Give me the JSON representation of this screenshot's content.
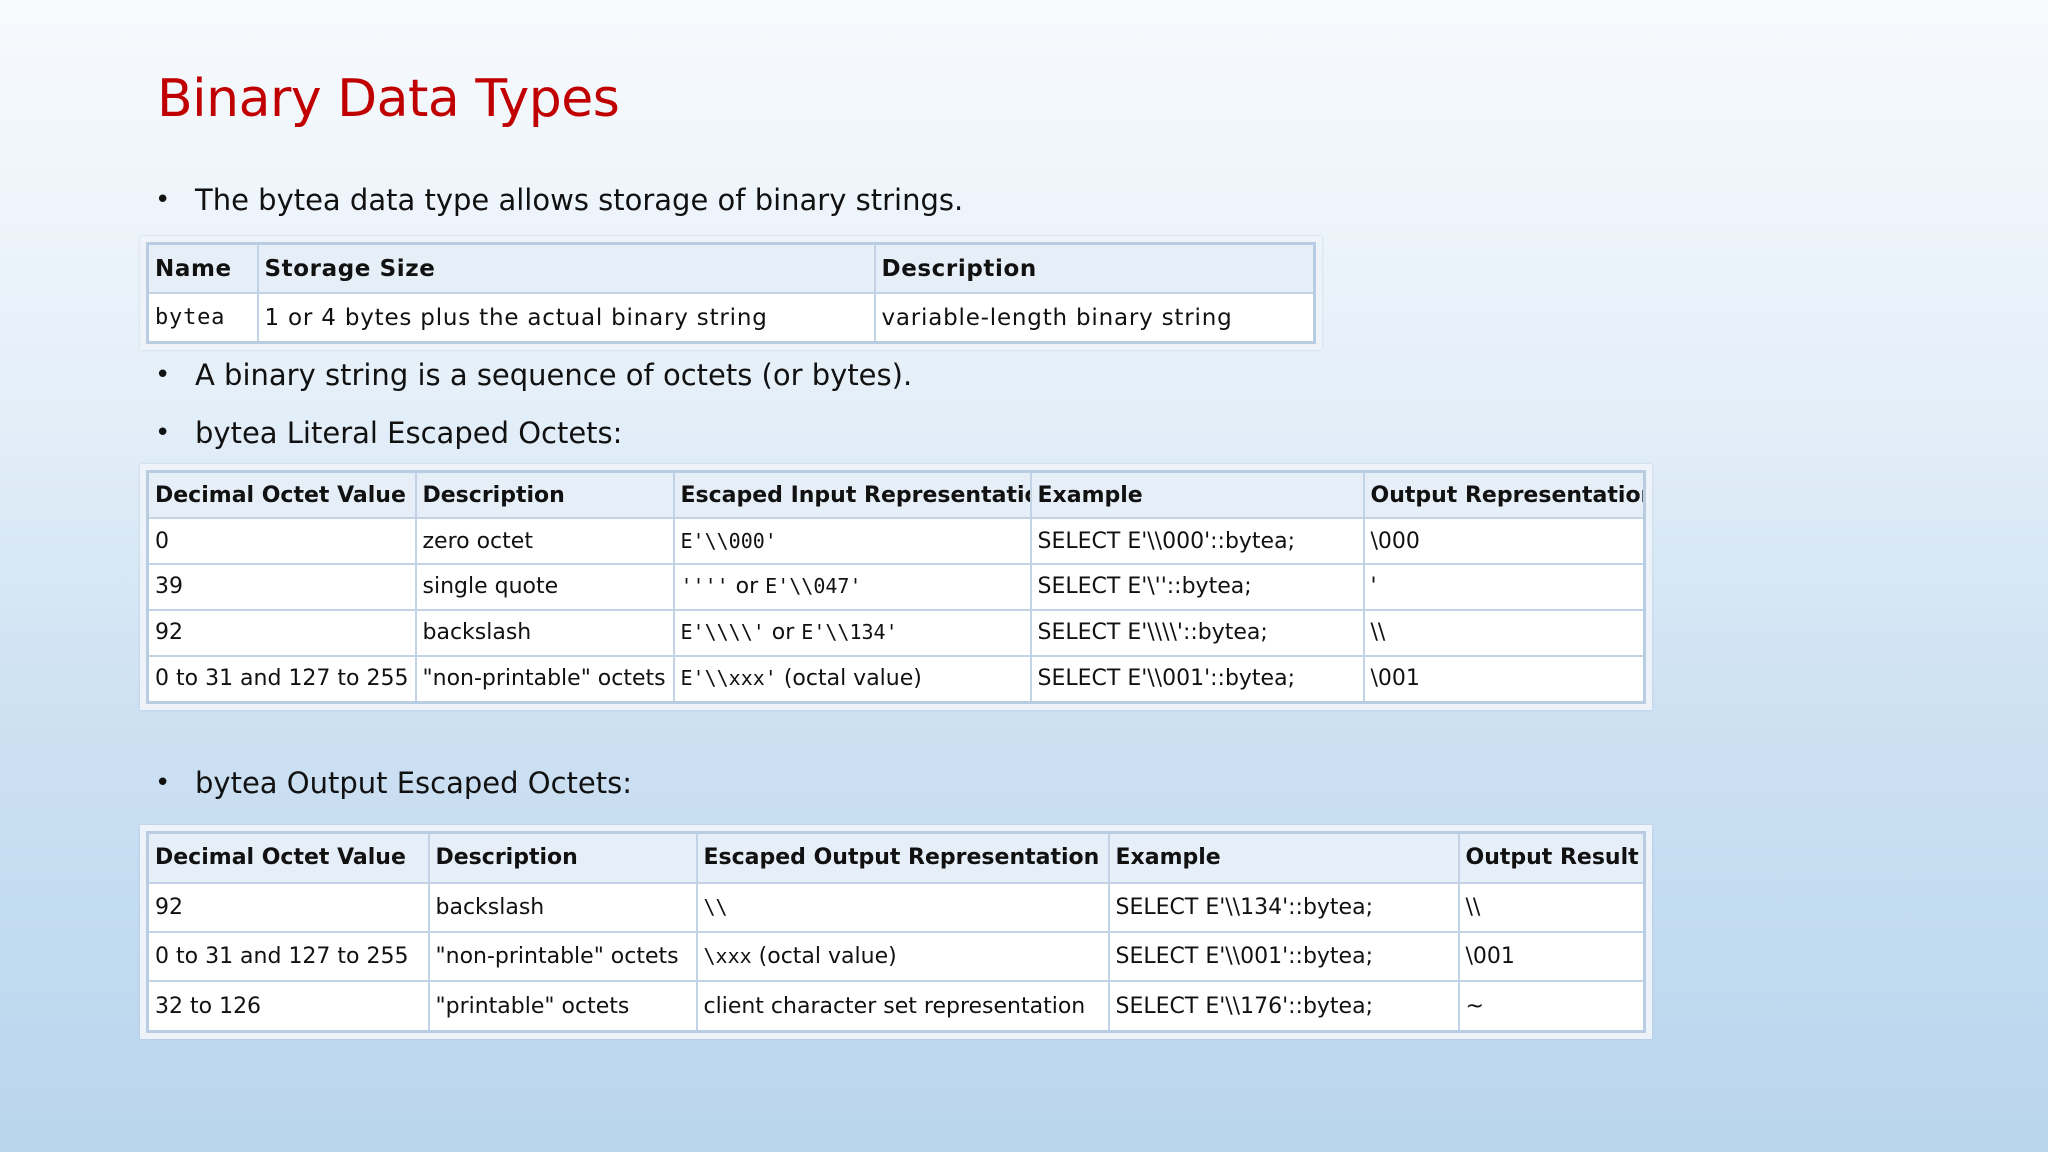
{
  "slide": {
    "title": "Binary Data Types",
    "bullets": [
      "The bytea data type allows storage of binary strings.",
      "A binary string is a sequence of octets (or bytes).",
      "bytea Literal Escaped Octets:",
      "bytea Output Escaped Octets:"
    ],
    "bullet_symbol": "•"
  },
  "storage_table": {
    "headers": [
      "Name",
      "Storage Size",
      "Description"
    ],
    "rows": [
      [
        "bytea",
        "1 or 4 bytes plus the actual binary string",
        "variable-length binary string"
      ]
    ]
  },
  "literal_table": {
    "headers": [
      "Decimal Octet Value",
      "Description",
      "Escaped Input Representation",
      "Example",
      "Output Representation"
    ],
    "rows": [
      {
        "value": "0",
        "description": "zero octet",
        "escaped": {
          "code1": "E'\\\\000'",
          "sep": "",
          "code2": "",
          "note": ""
        },
        "example": "SELECT E'\\\\000'::bytea;",
        "output": "\\000"
      },
      {
        "value": "39",
        "description": "single quote",
        "escaped": {
          "code1": "''''",
          "sep": " or ",
          "code2": "E'\\\\047'",
          "note": ""
        },
        "example": "SELECT E'\\''::bytea;",
        "output": "'"
      },
      {
        "value": "92",
        "description": "backslash",
        "escaped": {
          "code1": "E'\\\\\\\\'",
          "sep": " or ",
          "code2": "E'\\\\134'",
          "note": ""
        },
        "example": "SELECT E'\\\\\\\\'::bytea;",
        "output": "\\\\"
      },
      {
        "value": "0 to 31 and 127 to 255",
        "description": "\"non-printable\" octets",
        "escaped": {
          "code1": "E'\\\\xxx'",
          "sep": "",
          "code2": "",
          "note": " (octal value)"
        },
        "example": "SELECT E'\\\\001'::bytea;",
        "output": "\\001"
      }
    ]
  },
  "output_table": {
    "headers": [
      "Decimal Octet Value",
      "Description",
      "Escaped Output Representation",
      "Example",
      "Output Result"
    ],
    "rows": [
      {
        "value": "92",
        "description": "backslash",
        "escaped": {
          "code": "\\\\",
          "note": ""
        },
        "example": "SELECT E'\\\\134'::bytea;",
        "output": "\\\\"
      },
      {
        "value": "0 to 31 and 127 to 255",
        "description": "\"non-printable\" octets",
        "escaped": {
          "code": "\\xxx",
          "note": " (octal value)"
        },
        "example": "SELECT E'\\\\001'::bytea;",
        "output": "\\001"
      },
      {
        "value": "32 to 126",
        "description": "\"printable\" octets",
        "escaped": {
          "code": "",
          "note": "client character set representation"
        },
        "example": "SELECT E'\\\\176'::bytea;",
        "output": "~"
      }
    ]
  }
}
